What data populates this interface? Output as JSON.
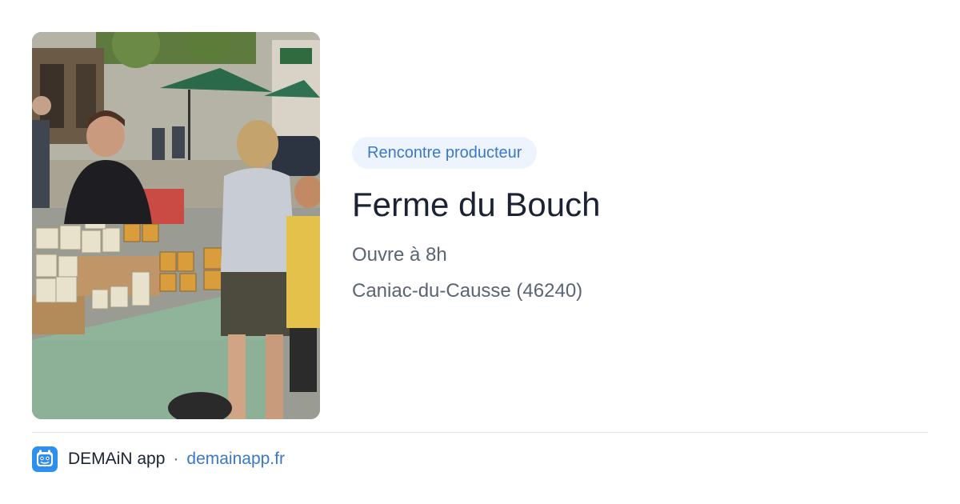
{
  "photo": {
    "description_icon": "market-stall-photo"
  },
  "event": {
    "category": "Rencontre producteur",
    "title": "Ferme du Bouch",
    "hours": "Ouvre à 8h",
    "location": "Caniac-du-Causse (46240)"
  },
  "footer": {
    "app_name": "DEMAiN app",
    "separator": "·",
    "url": "demainapp.fr",
    "logo_icon": "demain-app-logo-icon"
  },
  "colors": {
    "accent": "#3a78c9",
    "badge_bg": "#eef4fd",
    "title": "#1a2233",
    "meta": "#5a6473",
    "logo_bg": "#2f8ff0"
  }
}
